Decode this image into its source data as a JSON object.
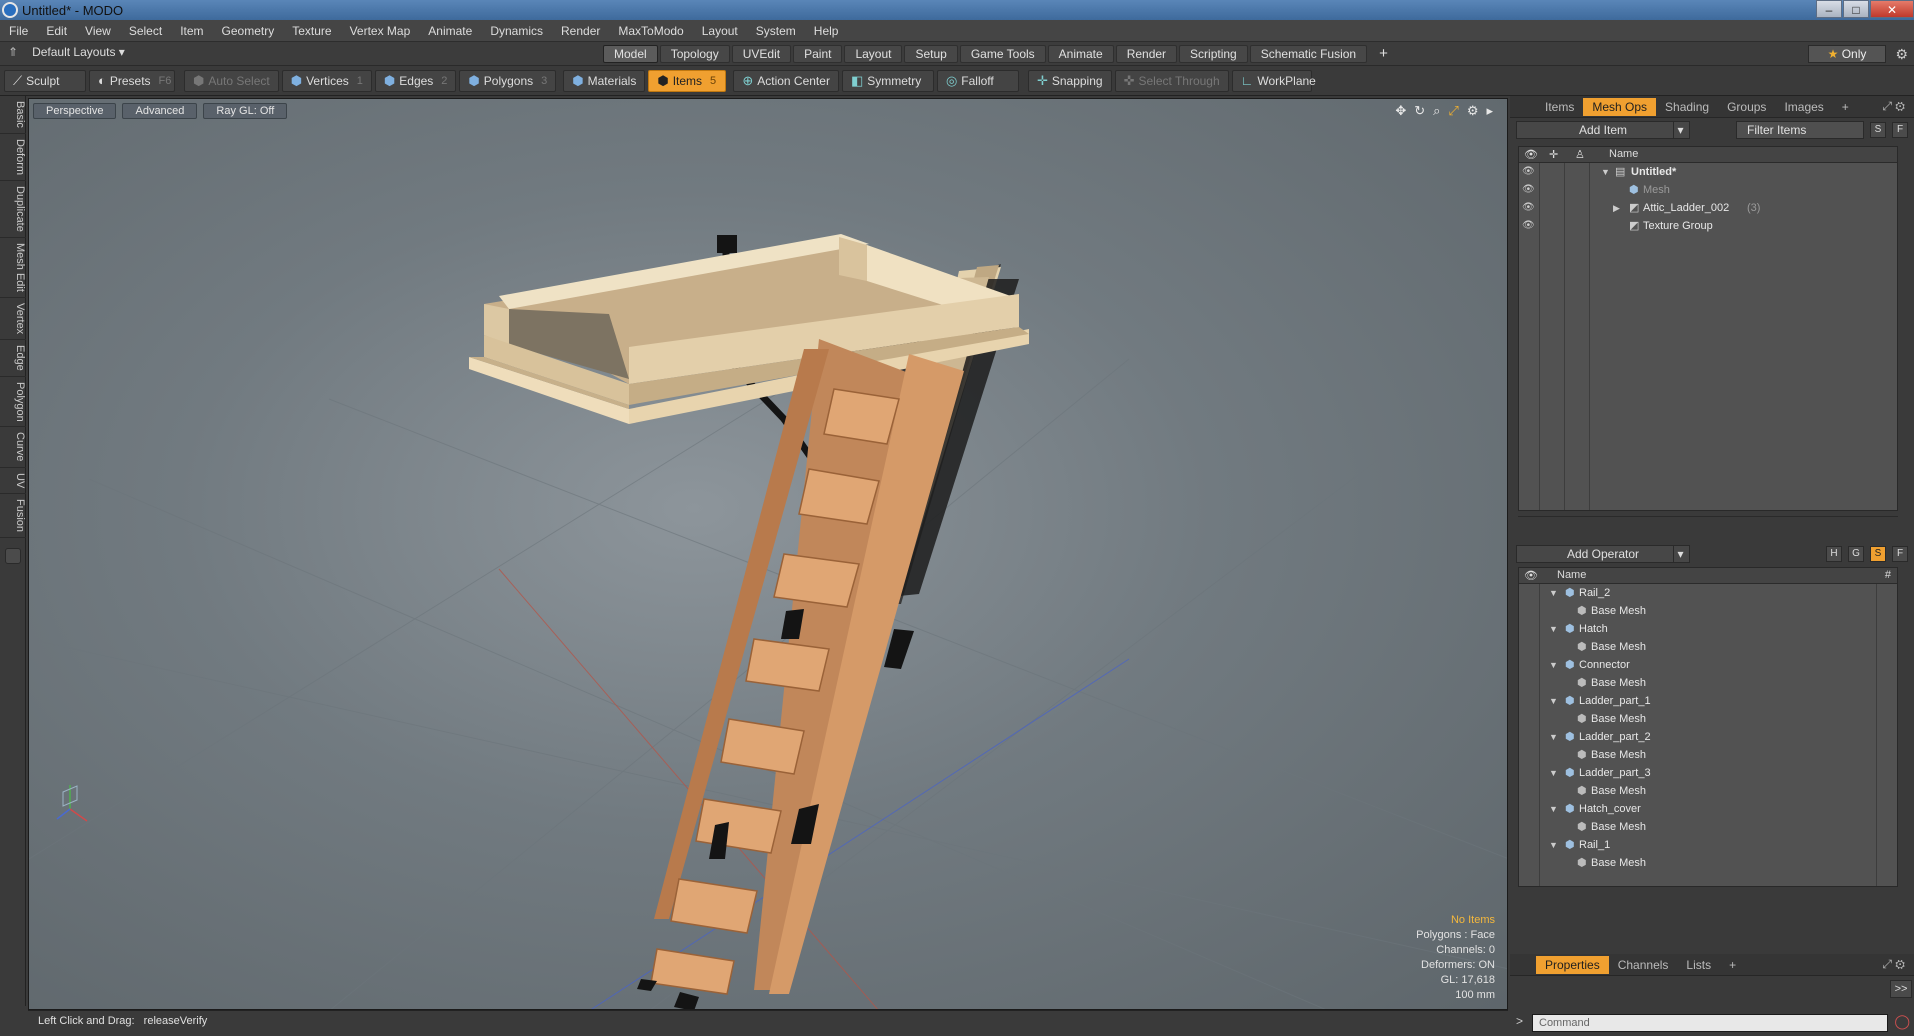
{
  "window": {
    "title": "Untitled* - MODO"
  },
  "menu": [
    "File",
    "Edit",
    "View",
    "Select",
    "Item",
    "Geometry",
    "Texture",
    "Vertex Map",
    "Animate",
    "Dynamics",
    "Render",
    "MaxToModo",
    "Layout",
    "System",
    "Help"
  ],
  "layout_menu": {
    "label": "Default Layouts"
  },
  "tabs": [
    "Model",
    "Topology",
    "UVEdit",
    "Paint",
    "Layout",
    "Setup",
    "Game Tools",
    "Animate",
    "Render",
    "Scripting",
    "Schematic Fusion"
  ],
  "add_tab": "+",
  "only_label": "Only",
  "toolbar": {
    "sculpt": "Sculpt",
    "presets": "Presets",
    "presets_key": "F6",
    "auto_select": "Auto Select",
    "vertices": "Vertices",
    "vertices_key": "1",
    "edges": "Edges",
    "edges_key": "2",
    "polygons": "Polygons",
    "polygons_key": "3",
    "materials": "Materials",
    "items": "Items",
    "items_key": "5",
    "action_center": "Action Center",
    "symmetry": "Symmetry",
    "falloff": "Falloff",
    "snapping": "Snapping",
    "select_through": "Select Through",
    "workplane": "WorkPlane"
  },
  "left_tabs": [
    "Basic",
    "Deform",
    "Duplicate",
    "Mesh Edit",
    "Vertex",
    "Edge",
    "Polygon",
    "Curve",
    "UV",
    "Fusion"
  ],
  "viewport": {
    "view": "Perspective",
    "mode": "Advanced",
    "raygl": "Ray GL: Off",
    "info": {
      "no_items": "No Items",
      "polygons": "Polygons : Face",
      "channels": "Channels: 0",
      "deformers": "Deformers: ON",
      "gl": "GL: 17,618",
      "unit": "100 mm"
    }
  },
  "status": {
    "left": "Left Click and Drag:",
    "action": "releaseVerify"
  },
  "right_tabs": [
    "Items",
    "Mesh Ops",
    "Shading",
    "Groups",
    "Images"
  ],
  "items_panel": {
    "add_item": "Add Item",
    "filter": "Filter Items",
    "s": "S",
    "f": "F",
    "name_col": "Name",
    "rows": [
      {
        "label": "Untitled*"
      },
      {
        "label": "Mesh"
      },
      {
        "label": "Attic_Ladder_002",
        "count": "(3)"
      },
      {
        "label": "Texture Group"
      }
    ]
  },
  "meshops_panel": {
    "add_operator": "Add Operator",
    "name_col": "Name",
    "hash": "#",
    "h": "H",
    "g": "G",
    "s": "S",
    "f": "F",
    "rows": [
      {
        "label": "Rail_2",
        "child": "Base Mesh"
      },
      {
        "label": "Hatch",
        "child": "Base Mesh"
      },
      {
        "label": "Connector",
        "child": "Base Mesh"
      },
      {
        "label": "Ladder_part_1",
        "child": "Base Mesh"
      },
      {
        "label": "Ladder_part_2",
        "child": "Base Mesh"
      },
      {
        "label": "Ladder_part_3",
        "child": "Base Mesh"
      },
      {
        "label": "Hatch_cover",
        "child": "Base Mesh"
      },
      {
        "label": "Rail_1",
        "child": "Base Mesh"
      }
    ]
  },
  "bottom_tabs": [
    "Properties",
    "Channels",
    "Lists"
  ],
  "command": {
    "placeholder": "Command",
    "expand": ">>"
  }
}
